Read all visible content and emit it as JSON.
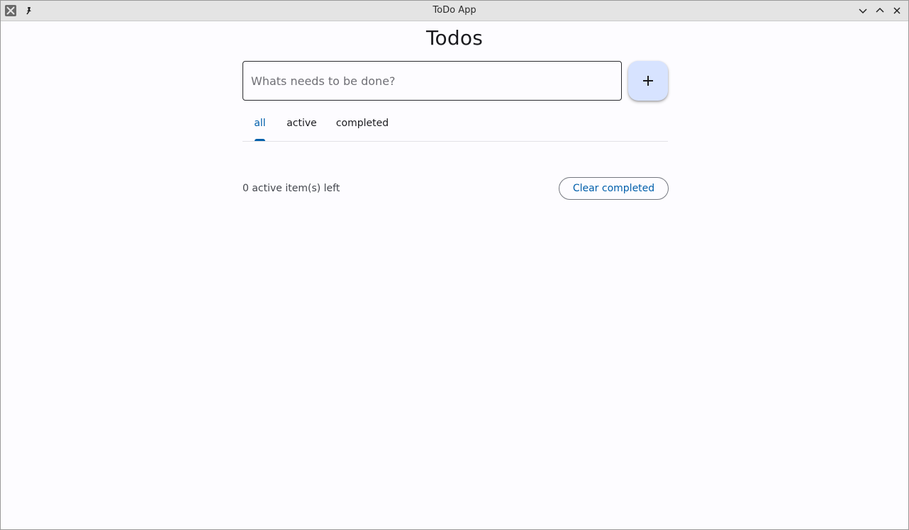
{
  "window": {
    "title": "ToDo App"
  },
  "page": {
    "heading": "Todos"
  },
  "new_todo": {
    "placeholder": "Whats needs to be done?",
    "value": "",
    "add_icon": "plus-icon"
  },
  "filters": {
    "tabs": [
      {
        "label": "all",
        "selected": true
      },
      {
        "label": "active",
        "selected": false
      },
      {
        "label": "completed",
        "selected": false
      }
    ]
  },
  "footer": {
    "status": "0 active item(s) left",
    "clear_label": "Clear completed"
  },
  "colors": {
    "accent": "#005fab",
    "add_button_bg": "#d7e3ff",
    "background": "#fdfcff"
  }
}
